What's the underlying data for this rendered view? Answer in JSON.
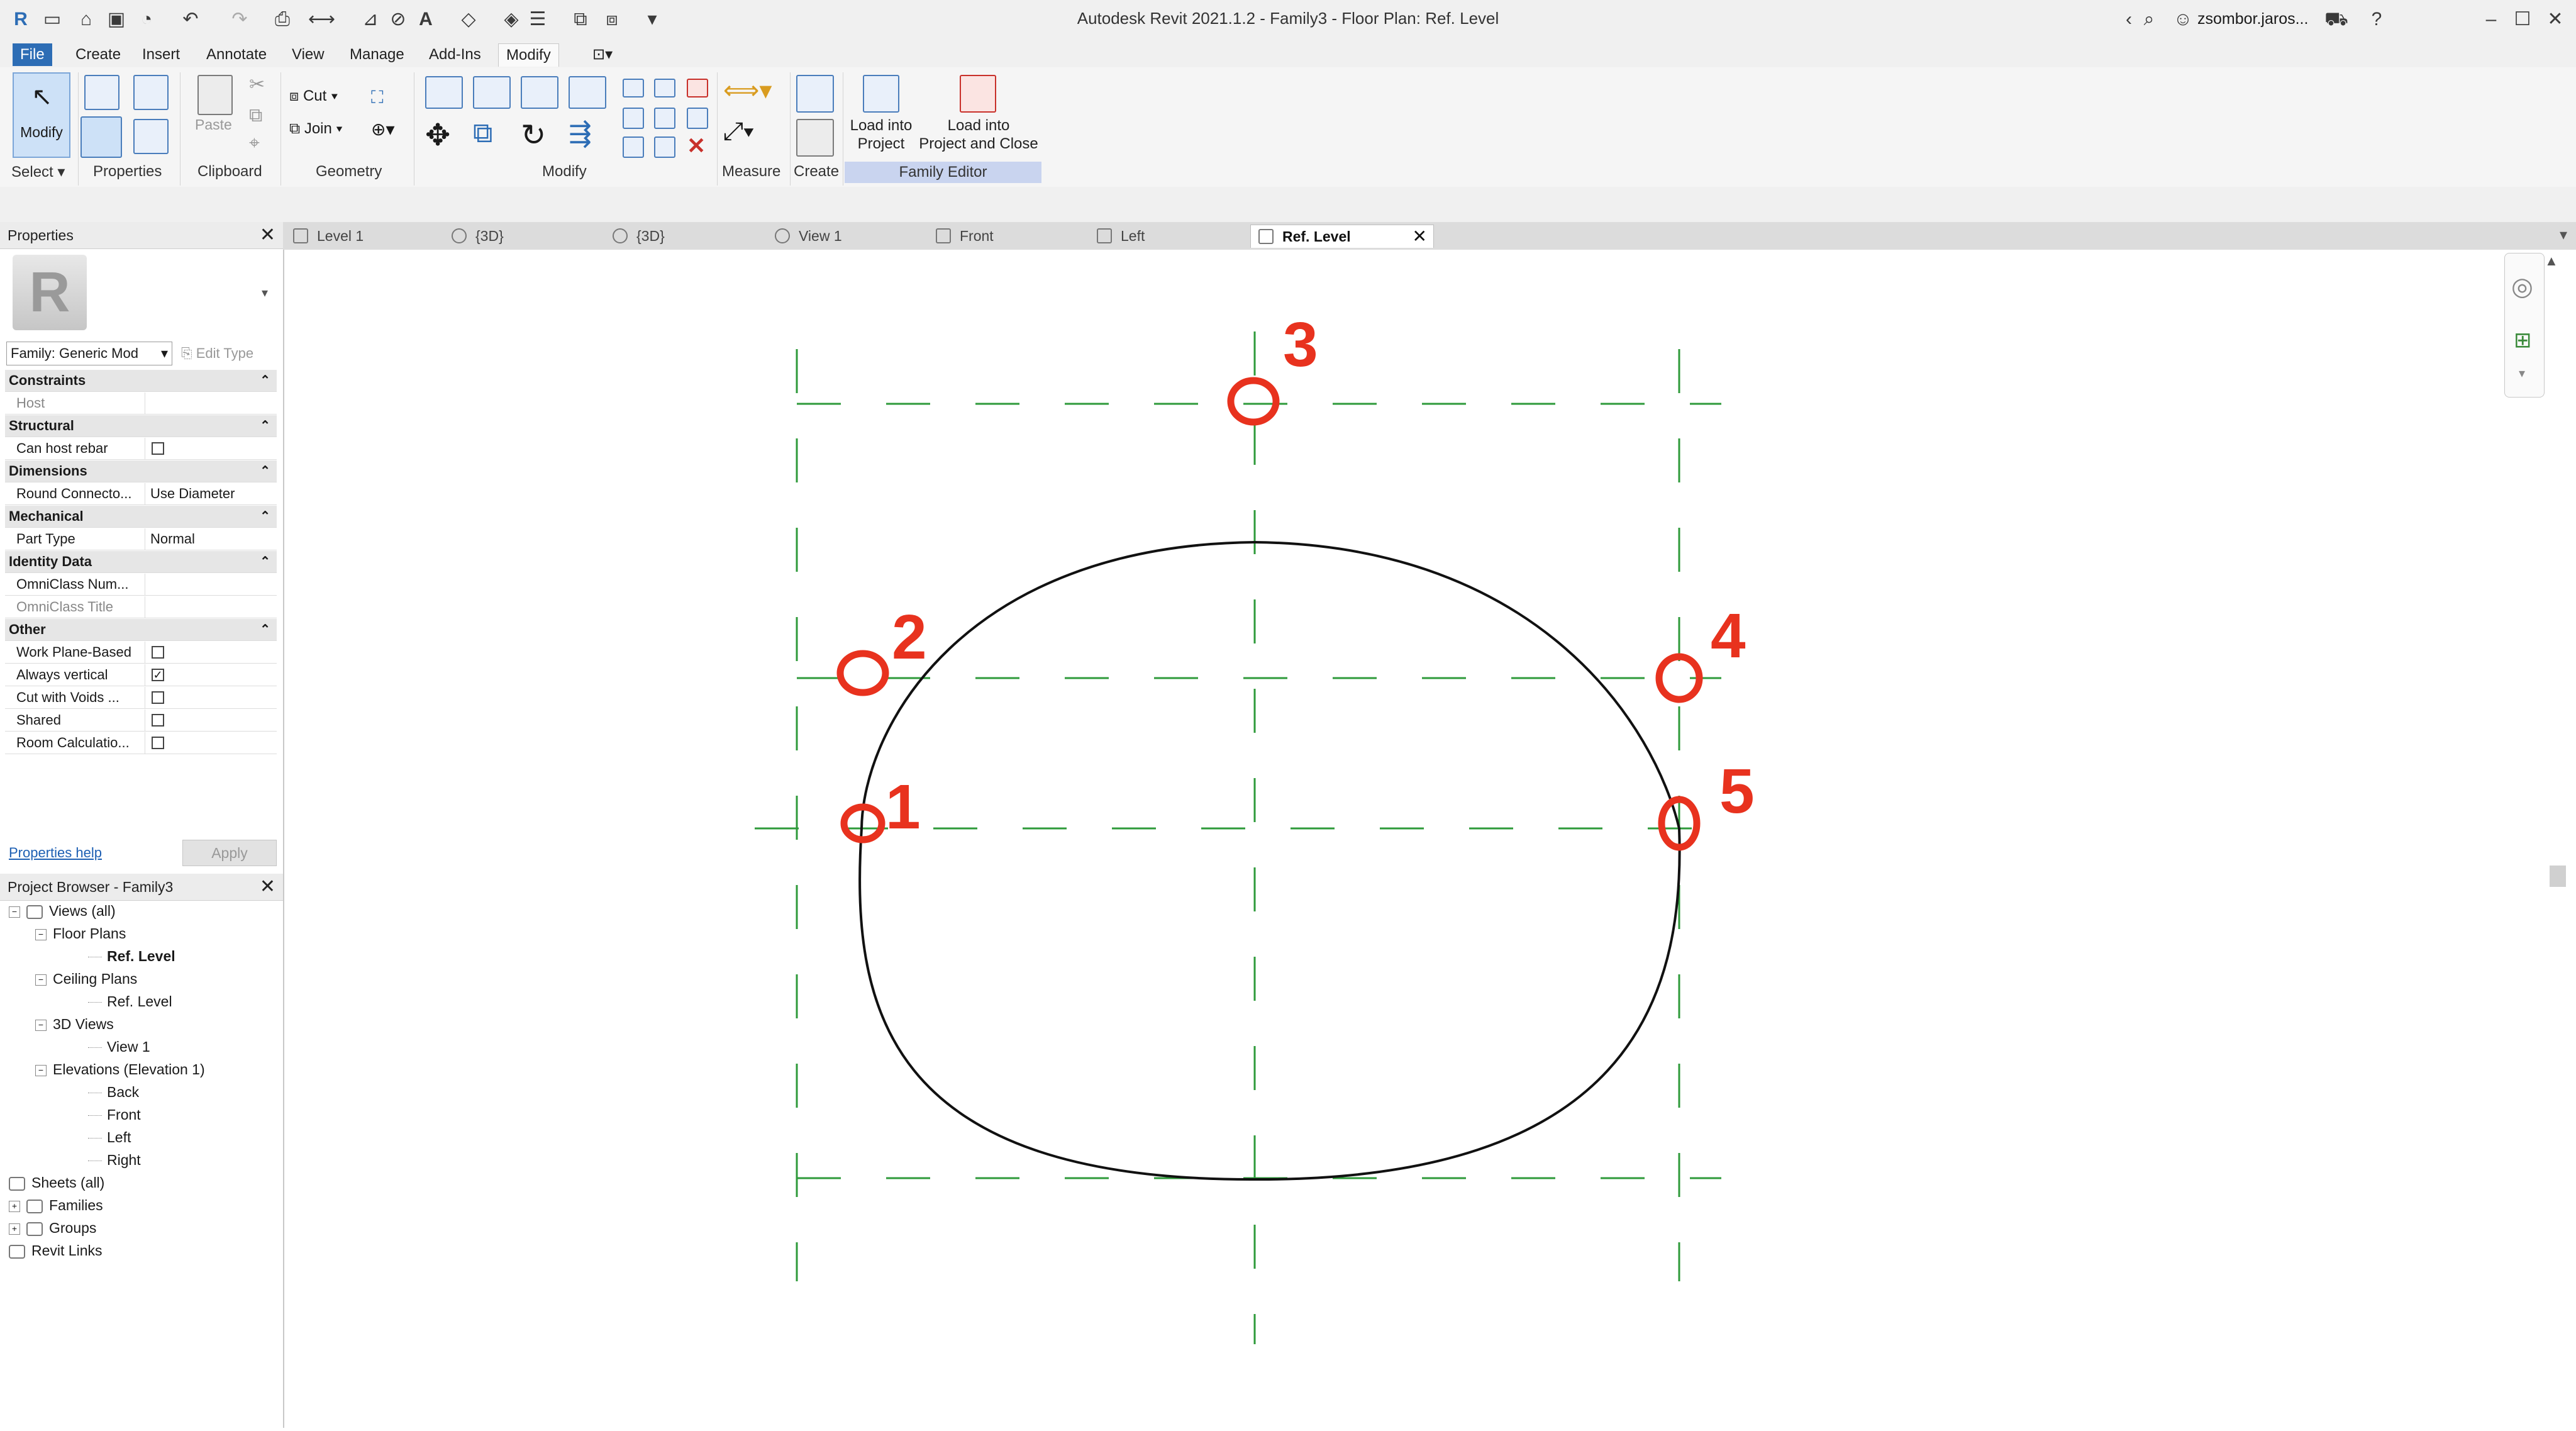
{
  "window": {
    "title": "Autodesk Revit 2021.1.2 - Family3 - Floor Plan: Ref. Level",
    "user": "zsombor.jaros...",
    "help": "?"
  },
  "ribbon": {
    "tabs": [
      "File",
      "Create",
      "Insert",
      "Annotate",
      "View",
      "Manage",
      "Add-Ins",
      "Modify"
    ],
    "active_tab": "Modify",
    "modify_label": "Modify",
    "select_label": "Select",
    "properties_label": "Properties",
    "paste_label": "Paste",
    "clipboard_label": "Clipboard",
    "cut_label": "Cut",
    "join_label": "Join",
    "geometry_label": "Geometry",
    "modify_panel_label": "Modify",
    "measure_label": "Measure",
    "create_label": "Create",
    "load_into_project": [
      "Load into",
      "Project"
    ],
    "load_into_project_close": [
      "Load into",
      "Project and Close"
    ],
    "family_editor_label": "Family Editor"
  },
  "view_tabs": [
    {
      "label": "Level 1"
    },
    {
      "label": "{3D}"
    },
    {
      "label": "{3D}"
    },
    {
      "label": "View 1"
    },
    {
      "label": "Front"
    },
    {
      "label": "Left"
    },
    {
      "label": "Ref. Level",
      "active": true
    }
  ],
  "properties": {
    "title": "Properties",
    "type_selector": "Family: Generic Mod",
    "edit_type": "Edit Type",
    "help_link": "Properties help",
    "apply": "Apply",
    "rows": [
      {
        "cat": "Constraints"
      },
      {
        "k": "Host",
        "v": "",
        "dim": true
      },
      {
        "cat": "Structural"
      },
      {
        "k": "Can host rebar",
        "cb": false
      },
      {
        "cat": "Dimensions"
      },
      {
        "k": "Round Connecto...",
        "v": "Use Diameter"
      },
      {
        "cat": "Mechanical"
      },
      {
        "k": "Part Type",
        "v": "Normal"
      },
      {
        "cat": "Identity Data"
      },
      {
        "k": "OmniClass Num...",
        "v": ""
      },
      {
        "k": "OmniClass Title",
        "v": "",
        "dim": true
      },
      {
        "cat": "Other"
      },
      {
        "k": "Work Plane-Based",
        "cb": false
      },
      {
        "k": "Always vertical",
        "cb": true
      },
      {
        "k": "Cut with Voids ...",
        "cb": false
      },
      {
        "k": "Shared",
        "cb": false
      },
      {
        "k": "Room Calculatio...",
        "cb": false
      }
    ]
  },
  "project_browser": {
    "title": "Project Browser - Family3",
    "items": [
      {
        "label": "Views (all)",
        "level": 0,
        "pm": "−"
      },
      {
        "label": "Floor Plans",
        "level": 1,
        "pm": "−"
      },
      {
        "label": "Ref. Level",
        "level": 2,
        "bold": true
      },
      {
        "label": "Ceiling Plans",
        "level": 1,
        "pm": "−"
      },
      {
        "label": "Ref. Level",
        "level": 2
      },
      {
        "label": "3D Views",
        "level": 1,
        "pm": "−"
      },
      {
        "label": "View 1",
        "level": 2
      },
      {
        "label": "Elevations (Elevation 1)",
        "level": 1,
        "pm": "−"
      },
      {
        "label": "Back",
        "level": 2
      },
      {
        "label": "Front",
        "level": 2
      },
      {
        "label": "Left",
        "level": 2
      },
      {
        "label": "Right",
        "level": 2
      },
      {
        "label": "Sheets (all)",
        "level": 0
      },
      {
        "label": "Families",
        "level": 0,
        "pm": "+"
      },
      {
        "label": "Groups",
        "level": 0,
        "pm": "+"
      },
      {
        "label": "Revit Links",
        "level": 0
      }
    ]
  },
  "canvas": {
    "annotations": [
      "1",
      "2",
      "3",
      "4",
      "5"
    ],
    "colors": {
      "reference": "#2e9a3a",
      "annotation": "#e8321e",
      "curve": "#111111"
    }
  }
}
